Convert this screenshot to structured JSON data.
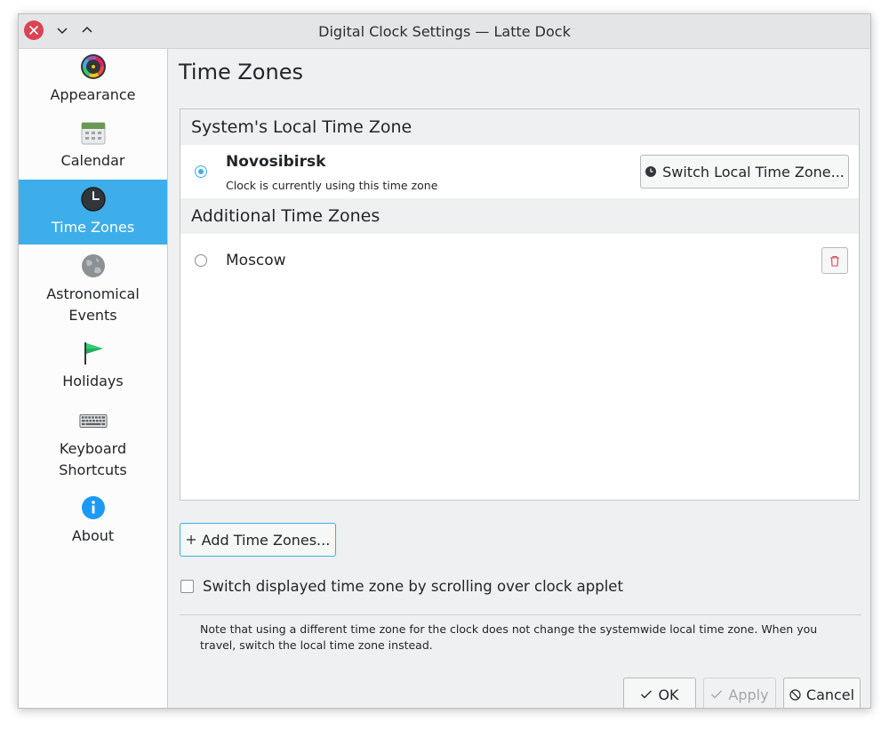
{
  "window": {
    "title": "Digital Clock Settings — Latte Dock"
  },
  "titlebar_buttons": {
    "close": "close-icon",
    "minimize": "chevron-down-icon",
    "maximize": "chevron-up-icon"
  },
  "sidebar": {
    "items": [
      {
        "label": "Appearance",
        "icon": "appearance-icon"
      },
      {
        "label": "Calendar",
        "icon": "calendar-icon"
      },
      {
        "label": "Time Zones",
        "icon": "clock-icon",
        "active": true
      },
      {
        "label": "Astronomical Events",
        "icon": "globe-icon"
      },
      {
        "label": "Holidays",
        "icon": "flag-icon"
      },
      {
        "label": "Keyboard Shortcuts",
        "icon": "keyboard-icon"
      },
      {
        "label": "About",
        "icon": "info-icon"
      }
    ]
  },
  "main": {
    "title": "Time Zones",
    "local_section": {
      "header": "System's Local Time Zone",
      "zone_name": "Novosibirsk",
      "zone_note": "Clock is currently using this time zone",
      "switch_button": "Switch Local Time Zone..."
    },
    "additional_section": {
      "header": "Additional Time Zones",
      "zones": [
        {
          "name": "Moscow"
        }
      ]
    },
    "add_button": "Add Time Zones...",
    "scroll_checkbox": "Switch displayed time zone by scrolling over clock applet",
    "note": "Note that using a different time zone for the clock does not change the systemwide local time zone. When you travel, switch the local time zone instead."
  },
  "footer": {
    "ok": "OK",
    "apply": "Apply",
    "cancel": "Cancel"
  },
  "colors": {
    "accent": "#3daee9",
    "close": "#da4453",
    "delete": "#da4453",
    "window_bg": "#eff0f1"
  }
}
